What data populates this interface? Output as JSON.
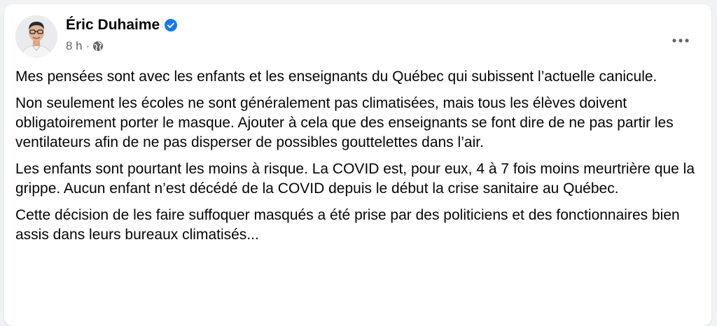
{
  "post": {
    "author": {
      "name": "Éric Duhaime",
      "verified": true
    },
    "meta": {
      "time": "8 h",
      "separator": "·",
      "audience_icon": "globe-icon"
    },
    "menu_icon": "more-horizontal-icon",
    "paragraphs": [
      "Mes pensées sont avec les enfants et les enseignants du Québec qui subissent l’actuelle canicule.",
      "Non seulement les écoles ne sont généralement pas climatisées, mais tous les élèves doivent obligatoirement porter le masque. Ajouter à cela que des enseignants se font dire de ne pas partir les ventilateurs afin de ne pas disperser de possibles gouttelettes dans l’air.",
      "Les enfants sont pourtant les moins à risque. La COVID est, pour eux, 4 à 7 fois moins meurtrière que la grippe. Aucun enfant n’est décédé de la COVID depuis le début la crise sanitaire au Québec.",
      "Cette décision de les faire suffoquer masqués a été prise par des politiciens et des fonctionnaires bien assis dans leurs bureaux climatisés..."
    ]
  },
  "colors": {
    "verified_badge": "#1877f2",
    "secondary_text": "#65676b",
    "primary_text": "#050505"
  }
}
